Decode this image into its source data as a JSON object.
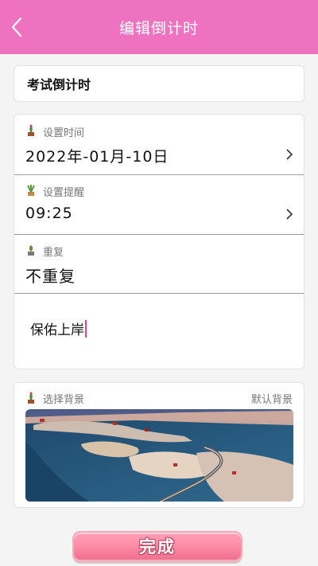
{
  "header": {
    "title": "编辑倒计时",
    "back_icon": "chevron-left-icon"
  },
  "title_field": {
    "value": "考试倒计时"
  },
  "time_row": {
    "label": "设置时间",
    "value": "2022年-01月-10日"
  },
  "remind_row": {
    "label": "设置提醒",
    "value": "09:25"
  },
  "repeat_row": {
    "label": "重复",
    "value": "不重复"
  },
  "note": {
    "value": "保佑上岸"
  },
  "background": {
    "label": "选择背景",
    "default_label": "默认背景"
  },
  "done_button": {
    "label": "完成"
  },
  "colors": {
    "accent": "#ef72c1",
    "button": "#ff8fa8"
  }
}
